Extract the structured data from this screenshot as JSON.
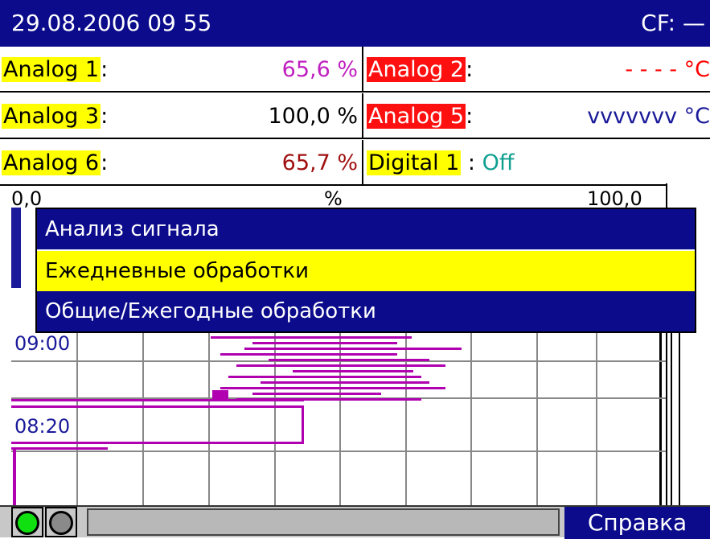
{
  "titlebar": {
    "datetime": "29.08.2006 09 55",
    "cf": "CF: —"
  },
  "channels": {
    "row1": {
      "left": {
        "label": "Analog 1",
        "value": "65,6 %",
        "value_color": "#c020c0"
      },
      "right": {
        "label": "Analog 2",
        "value": "- - - -  °C",
        "value_color": "#ff0000"
      }
    },
    "row2": {
      "left": {
        "label": "Analog 3",
        "value": "100,0 %",
        "value_color": "#000000"
      },
      "right": {
        "label": "Analog 5",
        "value": "vvvvvvv  °C",
        "value_color": "#1a1a9a"
      }
    },
    "row3": {
      "left": {
        "label": "Analog 6",
        "value": "65,7 %",
        "value_color": "#a01010"
      },
      "right": {
        "label": "Digital 1",
        "value": "Off",
        "value_color": "#10a090"
      }
    }
  },
  "scale": {
    "min": "0,0",
    "unit": "%",
    "max": "100,0"
  },
  "chart": {
    "time_labels": [
      "09:00",
      "08:20"
    ]
  },
  "menu": {
    "title": "Анализ сигнала",
    "items": [
      "Ежедневные обработки",
      "Общие/Ежегодные обработки"
    ]
  },
  "bottombar": {
    "help_label": "Справка"
  },
  "colors": {
    "titlebar": "#0b0b8c",
    "highlight": "#ffff00",
    "alarm": "#ff1010",
    "trace": "#b000b0"
  },
  "icons": [
    "status-led-green",
    "status-led-gray"
  ]
}
